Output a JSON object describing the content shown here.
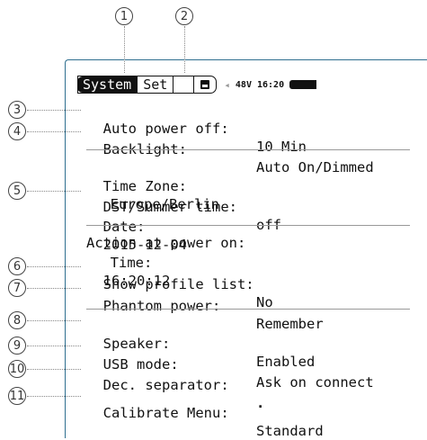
{
  "callouts": [
    "1",
    "2",
    "3",
    "4",
    "5",
    "6",
    "7",
    "8",
    "9",
    "10",
    "11"
  ],
  "tabs": {
    "system": "System",
    "set": "Set"
  },
  "status": {
    "voltage_time": "48V 16:20",
    "icons": [
      "speaker-icon",
      "battery-icon",
      "save-icon"
    ]
  },
  "settings": {
    "auto_power_off": {
      "label": "Auto power off:",
      "value": "10 Min"
    },
    "backlight": {
      "label": "Backlight:",
      "value": "Auto On/Dimmed"
    },
    "time_zone": {
      "label": "Time Zone:",
      "value": "Europe/Berlin"
    },
    "dst": {
      "label": "DST/Summer time:",
      "value": "off"
    },
    "date": {
      "label": "Date:",
      "value": "2015-12-04"
    },
    "time": {
      "label": "Time:",
      "value": "16:20:12"
    },
    "action_header": "Action at power on:",
    "show_profile_list": {
      "label": "Show profile list:",
      "value": "No"
    },
    "phantom_power": {
      "label": "Phantom power:",
      "value": "Remember"
    },
    "speaker": {
      "label": "Speaker:",
      "value": "Enabled"
    },
    "usb_mode": {
      "label": "USB mode:",
      "value": "Ask on connect"
    },
    "dec_separator": {
      "label": "Dec. separator:",
      "value": "."
    },
    "calibrate_menu": {
      "label": "Calibrate Menu:",
      "value": "Standard"
    }
  }
}
